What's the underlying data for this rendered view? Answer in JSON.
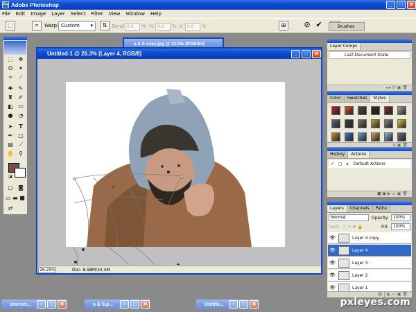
{
  "app": {
    "title": "Adobe Photoshop",
    "logo": "Ps"
  },
  "menu": [
    "File",
    "Edit",
    "Image",
    "Layer",
    "Select",
    "Filter",
    "View",
    "Window",
    "Help"
  ],
  "options_bar": {
    "warp_label": "Warp:",
    "warp_value": "Custom",
    "bend_label": "Bend:",
    "bend_value": "0.0",
    "h_label": "H:",
    "h_value": "0.0",
    "v_label": "V:",
    "v_value": "0.0",
    "percent": "%",
    "brushes_tab": "Brushes"
  },
  "documents": {
    "back": {
      "title": "a & b copy.jpg @ 12.5% (RGB/8#)"
    },
    "main": {
      "title": "Untitled-1 @ 26.3% (Layer 4, RGB/8)",
      "zoom": "26.25%",
      "doc_size": "Doc: 8.98M/33.4M"
    }
  },
  "palettes": {
    "layer_comps": {
      "tab": "Layer Comps",
      "row": "Last Document State"
    },
    "styles": {
      "tabs": [
        "Color",
        "Swatches",
        "Styles"
      ],
      "active_tab": "Styles",
      "swatches": [
        "#b3282a",
        "#d9562b",
        "#4d4d4d",
        "#2c2c2c",
        "#8a2a2a",
        "#a5a5a5",
        "#5e6a7d",
        "#3d3d3d",
        "#707070",
        "#c8a035",
        "#7f7f7f",
        "#e2c53a",
        "#c88a3b",
        "#4178c4",
        "#5aa8dc",
        "#d2a05a",
        "#8ab6e0",
        "#6a6a8a"
      ]
    },
    "actions": {
      "tabs": [
        "History",
        "Actions"
      ],
      "active_tab": "Actions",
      "row": "Default Actions"
    },
    "layers": {
      "tabs": [
        "Layers",
        "Channels",
        "Paths"
      ],
      "active_tab": "Layers",
      "blend_mode": "Normal",
      "opacity_label": "Opacity:",
      "opacity_value": "100%",
      "lock_label": "Lock:",
      "fill_label": "Fill:",
      "fill_value": "100%",
      "rows": [
        {
          "name": "Layer 4 copy",
          "selected": false
        },
        {
          "name": "Layer 4",
          "selected": true
        },
        {
          "name": "Layer 3",
          "selected": false
        },
        {
          "name": "Layer 2",
          "selected": false
        },
        {
          "name": "Layer 1",
          "selected": false
        }
      ]
    }
  },
  "minimized": [
    "sourcei...",
    "a & b.p...",
    "Untitle..."
  ],
  "watermark": "pxleyes.com",
  "colors": {
    "foreground": "#7a5042",
    "background": "#ffffff",
    "xp_blue": "#0b46c8",
    "selection": "#3169c6"
  }
}
